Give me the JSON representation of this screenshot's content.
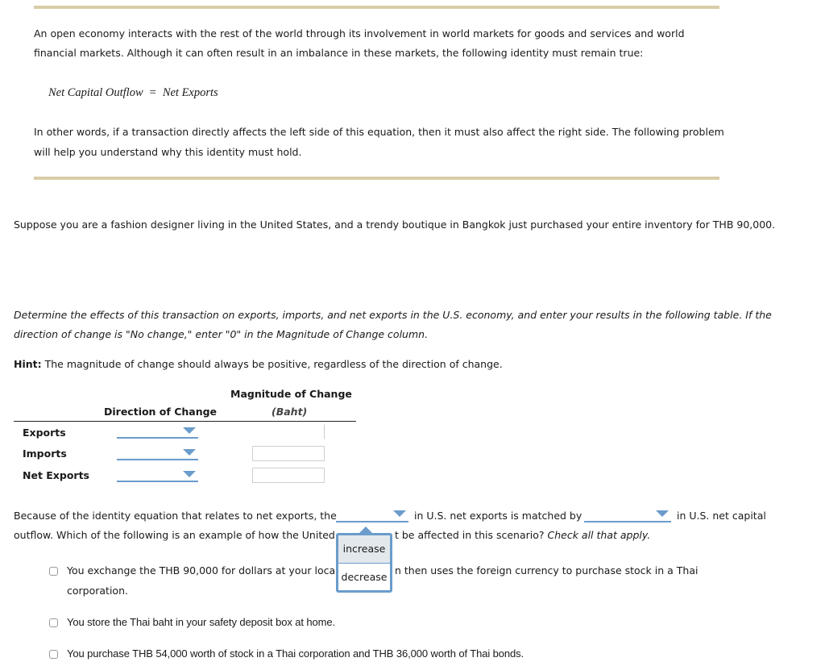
{
  "intro": {
    "para1_line1": "An open economy interacts with the rest of the world through its involvement in world markets for goods and services and world",
    "para1_line2": "financial markets. Although it can often result in an imbalance in these markets, the following identity must remain true:",
    "equation": {
      "left": "Net Capital Outflow",
      "operator": "=",
      "right": "Net Exports"
    },
    "para2_line1": "In other words, if a transaction directly affects the left side of this equation, then it must also affect the right side. The following problem",
    "para2_line2": "will help you understand why this identity must hold."
  },
  "scenario": "Suppose you are a fashion designer living in the United States, and a trendy boutique in Bangkok just purchased your entire inventory for THB 90,000.",
  "instructions": {
    "line1": "Determine the effects of this transaction on exports, imports, and net exports in the U.S. economy, and enter your results in the following table. If the",
    "line2": "direction of change is \"No change,\" enter \"0\" in the Magnitude of Change column.",
    "hint_label": "Hint:",
    "hint_text": " The magnitude of change should always be positive, regardless of the direction of change."
  },
  "table": {
    "col_direction": "Direction of Change",
    "col_magnitude": "Magnitude of Change",
    "col_magnitude_unit": "(Baht)",
    "rows": [
      {
        "label": "Exports",
        "direction": "",
        "magnitude": ""
      },
      {
        "label": "Imports",
        "direction": "",
        "magnitude": ""
      },
      {
        "label": "Net Exports",
        "direction": "",
        "magnitude": ""
      }
    ]
  },
  "identity_question": {
    "part1": "Because of the identity equation that relates to net exports, the",
    "part2": "in U.S. net exports is matched by",
    "part3": "in U.S. net capital",
    "line2a": "outflow. Which of the following is an example of how the United",
    "line2b": "t be affected in this scenario?",
    "line2c": "Check all that apply.",
    "dropdown1_value": "",
    "dropdown2_value": "",
    "open_dropdown_options": [
      "increase",
      "decrease"
    ],
    "highlighted_option": "increase"
  },
  "options": [
    {
      "line1a": "You exchange the THB 90,000 for dollars at your local",
      "line1b": "n then uses the foreign currency to purchase stock in a Thai",
      "line2": "corporation.",
      "checked": false
    },
    {
      "text": "You store the Thai baht in your safety deposit box at home.",
      "checked": false
    },
    {
      "text": "You purchase THB 54,000 worth of stock in a Thai corporation and THB 36,000 worth of Thai bonds.",
      "checked": false
    }
  ]
}
